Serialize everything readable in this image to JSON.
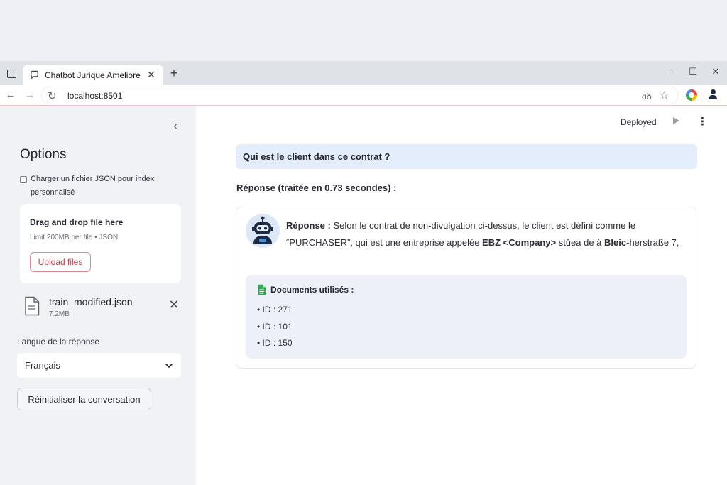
{
  "browser": {
    "tab_title": "Chatbot Jurique Ameliore",
    "url": "localhost:8501",
    "new_tab_label": "+",
    "reader_label": "ɑꝺ",
    "win_min": "–",
    "win_max": "☐",
    "win_close": "✕"
  },
  "sidebar": {
    "collapse_glyph": "‹",
    "title": "Options",
    "checkbox_label": "Charger un fichier JSON pour index personnalisé",
    "checkbox_checked": false,
    "dropzone": {
      "title": "Drag and drop file here",
      "limit": "Limit 200MB per file • JSON",
      "upload_button": "Upload files"
    },
    "file": {
      "name": "train_modified.json",
      "size": "7.2MB",
      "remove_glyph": "✕"
    },
    "language_label": "Langue de la réponse",
    "language_value": "Français",
    "reset_button": "Réinitialiser la conversation"
  },
  "main": {
    "deploy_label": "Deployed",
    "kebab_glyph": "⋮",
    "question": "Qui est le client dans ce contrat ?",
    "response_header": "Réponse (traitée en 0.73 secondes) :",
    "answer": {
      "label": "Réponse :",
      "text_1": " Selon le contrat de non-divulgation ci-dessus, le client est défini comme le ",
      "purchaser": "“PURCHASER”",
      "text_2": ", qui est une entreprise appelée ",
      "company": "EBZ <Company>",
      "text_3": " stǔea de à ",
      "street_bold": "Bleic",
      "text_4": "-herstraße 7,"
    },
    "documents": {
      "title": "Documents utilisés :",
      "items": [
        "• ID : 271",
        "• ID : 101",
        "• ID : 150"
      ]
    }
  },
  "colors": {
    "accent_red": "#b9434b",
    "question_bg": "#e3edfb",
    "sidebar_bg": "#f0f2f6"
  }
}
